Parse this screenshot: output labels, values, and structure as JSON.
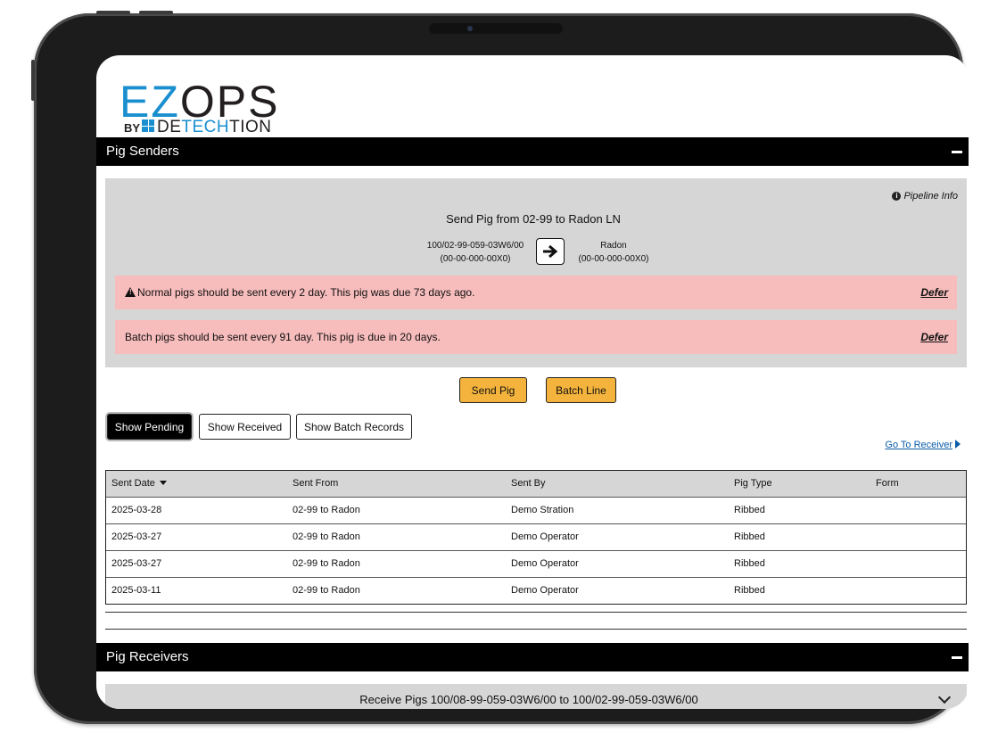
{
  "logo": {
    "ez": "EZ",
    "ops": "OPS",
    "by": "BY",
    "det_dark1": "DE",
    "det_blue": "TECH",
    "det_dark2": "TION"
  },
  "senders": {
    "title": "Pig Senders",
    "pipeline_info": "Pipeline Info",
    "send_title": "Send Pig from 02-99 to Radon LN",
    "from_line1": "100/02-99-059-03W6/00",
    "from_line2": "(00-00-000-00X0)",
    "to_line1": "Radon",
    "to_line2": "(00-00-000-00X0)",
    "alerts": [
      {
        "message": "Normal pigs should be sent every 2 day. This pig was due 73 days ago.",
        "action": "Defer"
      },
      {
        "message": "Batch pigs should be sent every 91 day. This pig is due in 20 days.",
        "action": "Defer"
      }
    ],
    "send_pig": "Send Pig",
    "batch_line": "Batch Line",
    "toggles": [
      "Show Pending",
      "Show Received",
      "Show Batch Records"
    ],
    "go_to_receiver": "Go To Receiver",
    "columns": [
      "Sent Date",
      "Sent From",
      "Sent By",
      "Pig Type",
      "Form"
    ],
    "rows": [
      [
        "2025-03-28",
        "02-99 to Radon",
        "Demo Stration",
        "Ribbed",
        ""
      ],
      [
        "2025-03-27",
        "02-99 to Radon",
        "Demo Operator",
        "Ribbed",
        ""
      ],
      [
        "2025-03-27",
        "02-99 to Radon",
        "Demo Operator",
        "Ribbed",
        ""
      ],
      [
        "2025-03-11",
        "02-99 to Radon",
        "Demo Operator",
        "Ribbed",
        ""
      ]
    ]
  },
  "receivers": {
    "title": "Pig Receivers",
    "receive_title": "Receive Pigs 100/08-99-059-03W6/00 to 100/02-99-059-03W6/00"
  },
  "colors": {
    "accent": "#f4b33c",
    "alert_bg": "#f7bcbc",
    "logo_blue": "#1a8fd0",
    "link": "#0b5ca8"
  }
}
